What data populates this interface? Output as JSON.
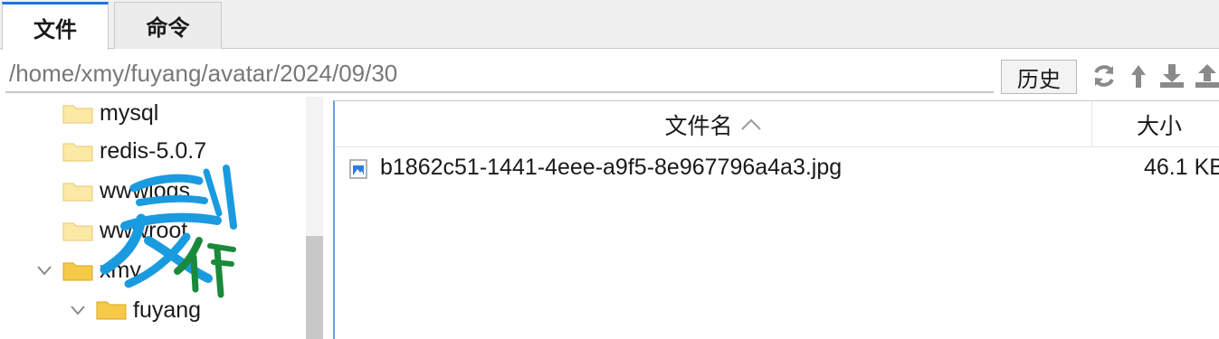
{
  "tabs": [
    {
      "label": "文件",
      "active": true
    },
    {
      "label": "命令",
      "active": false
    }
  ],
  "pathbar": {
    "path_value": "/home/xmy/fuyang/avatar/2024/09/30",
    "history_label": "历史",
    "tools": [
      "refresh-icon",
      "up-directory-icon",
      "download-icon",
      "upload-icon"
    ]
  },
  "tree": {
    "items": [
      {
        "label": "mysql",
        "expanded": null
      },
      {
        "label": "redis-5.0.7",
        "expanded": null
      },
      {
        "label": "wwwlogs",
        "expanded": null
      },
      {
        "label": "wwwroot",
        "expanded": null
      },
      {
        "label": "xmy",
        "expanded": true
      },
      {
        "label": "fuyang",
        "expanded": true
      }
    ]
  },
  "filelist": {
    "columns": {
      "name": "文件名",
      "size": "大小"
    },
    "sort": "ascending",
    "rows": [
      {
        "name": "b1862c51-1441-4eee-a9f5-8e967796a4a3.jpg",
        "size": "46.1 KB",
        "icon": "image-file-icon"
      }
    ]
  },
  "watermark": {
    "text": "爱制作"
  },
  "colors": {
    "accent": "#1a73e8",
    "folder": "#f7c948",
    "folder_light": "#fde9a6",
    "watermark_blue": "#1a9be0",
    "watermark_green": "#1a8a3a"
  }
}
